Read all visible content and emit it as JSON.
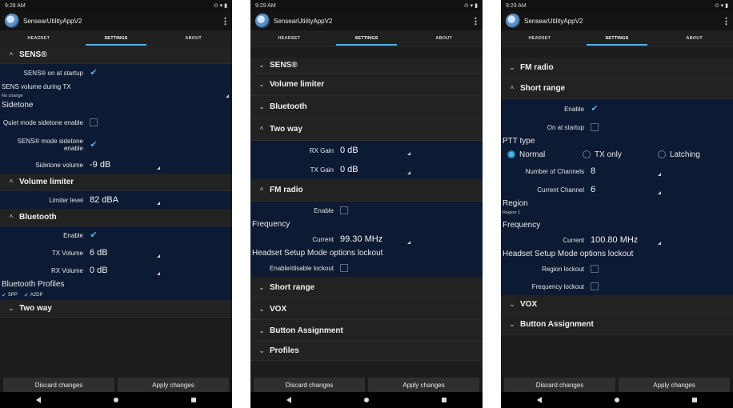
{
  "colors": {
    "accent": "#4fb3e8",
    "panel": "#0d1a33",
    "section": "#222222"
  },
  "status": {
    "p1_time": "9:28 AM",
    "p2_time": "9:29 AM",
    "p3_time": "9:29 AM"
  },
  "app": {
    "title": "SensearUtilityAppV2",
    "menu_icon": "⋮"
  },
  "tabs": {
    "headset": "HEADSET",
    "settings": "SETTINGS",
    "about": "ABOUT"
  },
  "chev": {
    "down": "⌄",
    "up": "^"
  },
  "actions": {
    "discard": "Discard changes",
    "apply": "Apply changes"
  },
  "screen1": {
    "sens_title": "SENS®",
    "sens_on_startup": "SENS® on at startup",
    "sens_vol_tx": "SENS volume during TX",
    "sens_vol_tx_value": "No change",
    "sidetone": "Sidetone",
    "quiet_mode": "Quiet mode sidetone enable",
    "sens_mode": "SENS® mode sidetone enable",
    "sidetone_volume": "Sidetone volume",
    "sidetone_volume_value": "-9 dB",
    "volume_limiter": "Volume limiter",
    "limiter_level": "Limiter level",
    "limiter_level_value": "82 dBA",
    "bluetooth": "Bluetooth",
    "enable": "Enable",
    "tx_volume": "TX Volume",
    "tx_volume_value": "6 dB",
    "rx_volume": "RX Volume",
    "rx_volume_value": "0 dB",
    "bt_profiles": "Bluetooth Profiles",
    "spp": "SPP",
    "a2dp": "A2DP",
    "two_way": "Two way"
  },
  "screen2": {
    "sens": "SENS®",
    "volume_limiter": "Volume limiter",
    "bluetooth": "Bluetooth",
    "two_way": "Two way",
    "rx_gain": "RX Gain",
    "rx_gain_value": "0 dB",
    "tx_gain": "TX Gain",
    "tx_gain_value": "0 dB",
    "fm_radio": "FM radio",
    "enable": "Enable",
    "frequency": "Frequency",
    "current": "Current",
    "current_value": "99.30 MHz",
    "lockout": "Headset Setup Mode options lockout",
    "enable_disable_lockout": "Enable/disable lockout",
    "short_range": "Short range",
    "vox": "VOX",
    "button_assignment": "Button Assignment",
    "profiles": "Profiles"
  },
  "screen3": {
    "fm_radio": "FM radio",
    "short_range": "Short range",
    "enable": "Enable",
    "on_at_startup": "On at startup",
    "ptt_type": "PTT type",
    "normal": "Normal",
    "tx_only": "TX only",
    "latching": "Latching",
    "num_channels": "Number of Channels",
    "num_channels_value": "8",
    "current_channel": "Current Channel",
    "current_channel_value": "6",
    "region": "Region",
    "region_value": "Region 1",
    "frequency": "Frequency",
    "current": "Current",
    "current_value": "100.80 MHz",
    "lockout": "Headset Setup Mode options lockout",
    "region_lockout": "Region lockout",
    "frequency_lockout": "Frequency lockout",
    "vox": "VOX",
    "button_assignment": "Button Assignment"
  }
}
